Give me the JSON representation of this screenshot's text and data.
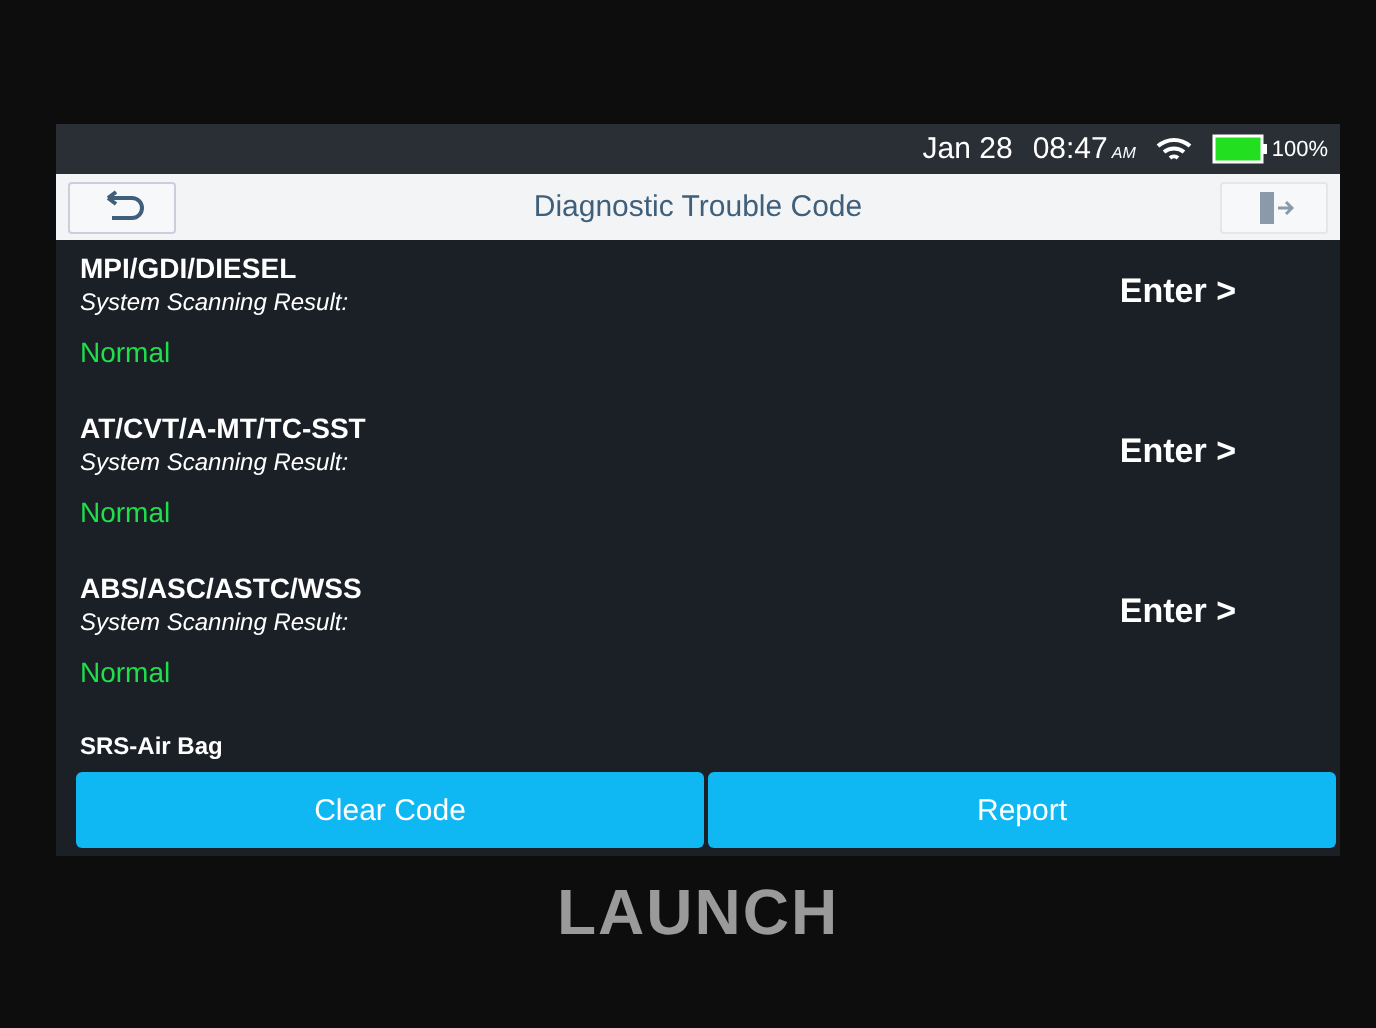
{
  "status_bar": {
    "date": "Jan 28",
    "time": "08:47",
    "meridiem": "AM",
    "battery": "100%"
  },
  "header": {
    "title": "Diagnostic Trouble Code"
  },
  "systems": [
    {
      "name": "MPI/GDI/DIESEL",
      "label": "System Scanning Result:",
      "result": "Normal",
      "action": "Enter >"
    },
    {
      "name": "AT/CVT/A-MT/TC-SST",
      "label": "System Scanning Result:",
      "result": "Normal",
      "action": "Enter >"
    },
    {
      "name": "ABS/ASC/ASTC/WSS",
      "label": "System Scanning Result:",
      "result": "Normal",
      "action": "Enter >"
    },
    {
      "name": "SRS-Air Bag"
    }
  ],
  "buttons": [
    "Clear Code",
    "Report"
  ],
  "device": {
    "brand": "LAUNCH"
  }
}
